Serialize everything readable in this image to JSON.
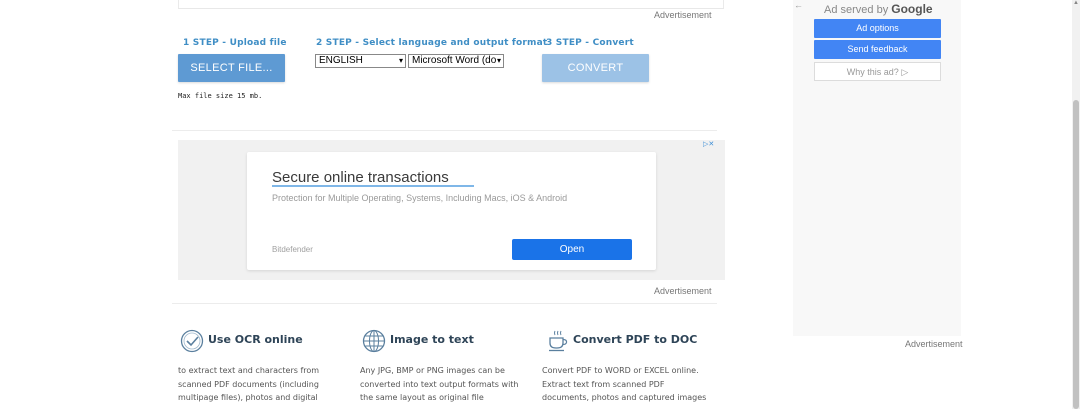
{
  "top": {
    "advertisement_label": "Advertisement"
  },
  "steps": {
    "step1_label": "1 STEP - Upload file",
    "step2_label": "2 STEP - Select language and output format",
    "step3_label": "3 STEP - Convert",
    "select_file_button": "SELECT FILE...",
    "language_value": "ENGLISH",
    "format_value": "Microsoft Word (do",
    "convert_button": "CONVERT",
    "max_file_note": "Max file size 15 mb."
  },
  "ad": {
    "title": "Secure online transactions",
    "description": "Protection for Multiple Operating, Systems, Including Macs, iOS & Android",
    "brand": "Bitdefender",
    "open_button": "Open",
    "advertisement_label": "Advertisement"
  },
  "features": [
    {
      "title": "Use OCR online",
      "icon": "checkmark-circle-icon",
      "lines": [
        "to extract text and characters from",
        "scanned PDF documents (including",
        "multipage files), photos and digital"
      ]
    },
    {
      "title": "Image to text",
      "icon": "globe-icon",
      "lines": [
        "Any JPG, BMP or PNG images can be",
        "converted into text output formats with",
        "the same layout as original file"
      ]
    },
    {
      "title": "Convert PDF to DOC",
      "icon": "coffee-cup-icon",
      "lines": [
        "Convert PDF to WORD or EXCEL online.",
        "Extract text from scanned PDF",
        "documents, photos and captured images"
      ]
    }
  ],
  "side_ad": {
    "served_by_prefix": "Ad served by",
    "served_by_brand": "Google",
    "ad_options": "Ad options",
    "send_feedback": "Send feedback",
    "why_this_ad": "Why this ad?",
    "advertisement_label": "Advertisement"
  },
  "colors": {
    "step_blue": "#3f8ec5",
    "button_blue": "#5e9ad3",
    "convert_disabled": "#9cc2e6",
    "google_blue": "#4285f4",
    "ad_open_blue": "#1a73e8"
  }
}
